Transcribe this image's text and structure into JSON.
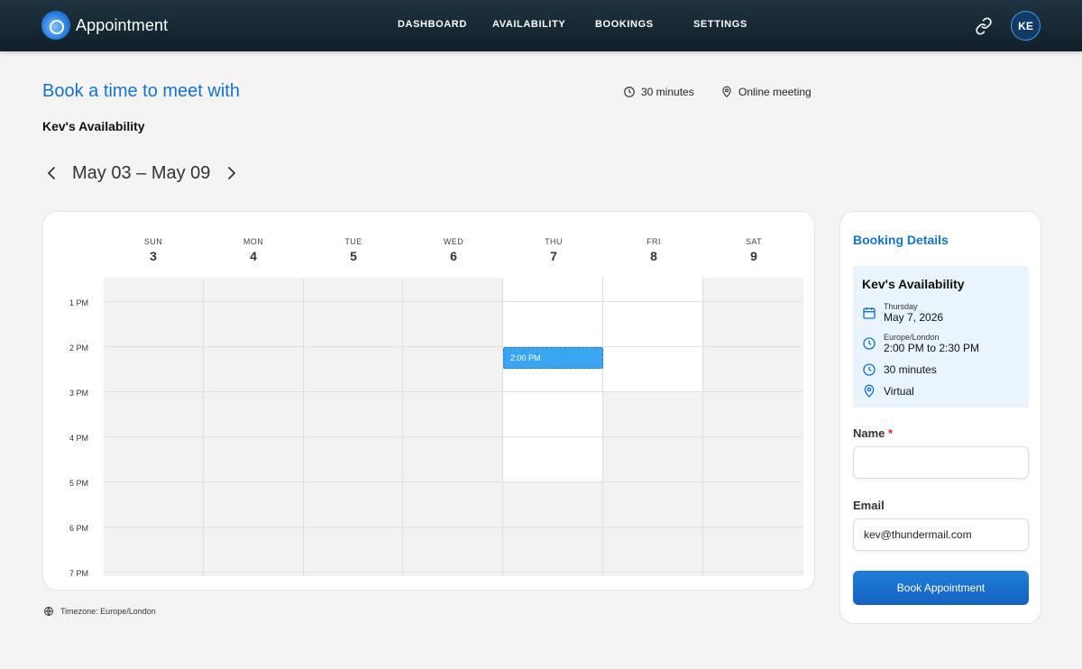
{
  "app": {
    "name": "Appointment"
  },
  "nav": [
    {
      "label": "DASHBOARD"
    },
    {
      "label": "AVAILABILITY"
    },
    {
      "label": "BOOKINGS"
    },
    {
      "label": "SETTINGS"
    }
  ],
  "user": {
    "initials": "KE"
  },
  "header": {
    "title": "Book a time to meet with",
    "duration": "30 minutes",
    "location": "Online meeting",
    "subtitle": "Kev's Availability"
  },
  "week": {
    "label": "May 03 – May 09"
  },
  "calendar": {
    "days": [
      {
        "name": "SUN",
        "date": "3",
        "available": false
      },
      {
        "name": "MON",
        "date": "4",
        "available": false
      },
      {
        "name": "TUE",
        "date": "5",
        "available": false
      },
      {
        "name": "WED",
        "date": "6",
        "available": false
      },
      {
        "name": "THU",
        "date": "7",
        "available": true
      },
      {
        "name": "FRI",
        "date": "8",
        "available": true
      },
      {
        "name": "SAT",
        "date": "9",
        "available": false
      }
    ],
    "times": [
      "1 PM",
      "2 PM",
      "3 PM",
      "4 PM",
      "5 PM",
      "6 PM",
      "7 PM"
    ],
    "selected_slot": {
      "label": "2:00 PM",
      "day": "THU"
    }
  },
  "timezone": {
    "label": "Timezone: Europe/London"
  },
  "booking": {
    "title": "Booking Details",
    "summary_title": "Kev's Availability",
    "day_name": "Thursday",
    "date": "May 7, 2026",
    "timezone": "Europe/London",
    "time_range": "2:00 PM to 2:30 PM",
    "duration": "30 minutes",
    "location": "Virtual",
    "name_label": "Name",
    "name_required": "*",
    "name_value": "",
    "email_label": "Email",
    "email_value": "kev@thundermail.com",
    "submit_label": "Book Appointment"
  },
  "colors": {
    "accent": "#1672cc",
    "topbar": "#1a2b35",
    "slot": "#3aa5f2",
    "details_bg": "#eaf4fd"
  },
  "icons": {
    "clock": "clock-icon",
    "pin": "location-pin-icon",
    "link": "link-icon",
    "globe": "globe-icon",
    "calendar": "calendar-icon",
    "prev": "chevron-left-icon",
    "next": "chevron-right-icon"
  }
}
